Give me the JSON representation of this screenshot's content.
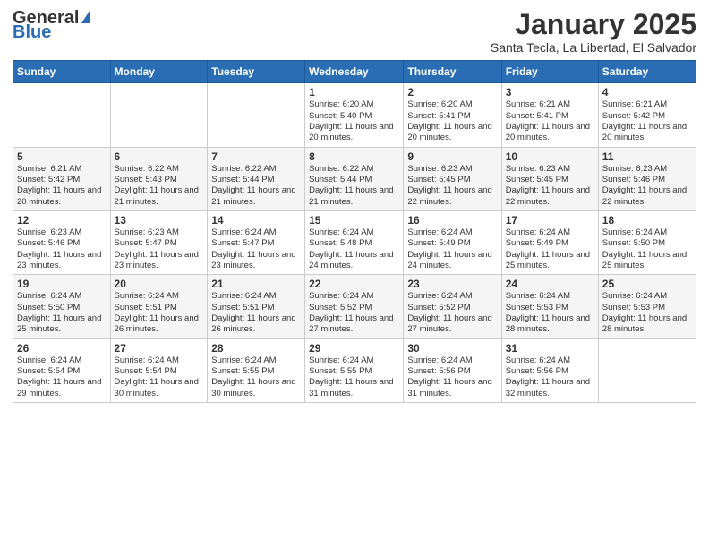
{
  "logo": {
    "general": "General",
    "blue": "Blue"
  },
  "title": "January 2025",
  "subtitle": "Santa Tecla, La Libertad, El Salvador",
  "days_header": [
    "Sunday",
    "Monday",
    "Tuesday",
    "Wednesday",
    "Thursday",
    "Friday",
    "Saturday"
  ],
  "weeks": [
    [
      {
        "day": "",
        "info": ""
      },
      {
        "day": "",
        "info": ""
      },
      {
        "day": "",
        "info": ""
      },
      {
        "day": "1",
        "info": "Sunrise: 6:20 AM\nSunset: 5:40 PM\nDaylight: 11 hours and 20 minutes."
      },
      {
        "day": "2",
        "info": "Sunrise: 6:20 AM\nSunset: 5:41 PM\nDaylight: 11 hours and 20 minutes."
      },
      {
        "day": "3",
        "info": "Sunrise: 6:21 AM\nSunset: 5:41 PM\nDaylight: 11 hours and 20 minutes."
      },
      {
        "day": "4",
        "info": "Sunrise: 6:21 AM\nSunset: 5:42 PM\nDaylight: 11 hours and 20 minutes."
      }
    ],
    [
      {
        "day": "5",
        "info": "Sunrise: 6:21 AM\nSunset: 5:42 PM\nDaylight: 11 hours and 20 minutes."
      },
      {
        "day": "6",
        "info": "Sunrise: 6:22 AM\nSunset: 5:43 PM\nDaylight: 11 hours and 21 minutes."
      },
      {
        "day": "7",
        "info": "Sunrise: 6:22 AM\nSunset: 5:44 PM\nDaylight: 11 hours and 21 minutes."
      },
      {
        "day": "8",
        "info": "Sunrise: 6:22 AM\nSunset: 5:44 PM\nDaylight: 11 hours and 21 minutes."
      },
      {
        "day": "9",
        "info": "Sunrise: 6:23 AM\nSunset: 5:45 PM\nDaylight: 11 hours and 22 minutes."
      },
      {
        "day": "10",
        "info": "Sunrise: 6:23 AM\nSunset: 5:45 PM\nDaylight: 11 hours and 22 minutes."
      },
      {
        "day": "11",
        "info": "Sunrise: 6:23 AM\nSunset: 5:46 PM\nDaylight: 11 hours and 22 minutes."
      }
    ],
    [
      {
        "day": "12",
        "info": "Sunrise: 6:23 AM\nSunset: 5:46 PM\nDaylight: 11 hours and 23 minutes."
      },
      {
        "day": "13",
        "info": "Sunrise: 6:23 AM\nSunset: 5:47 PM\nDaylight: 11 hours and 23 minutes."
      },
      {
        "day": "14",
        "info": "Sunrise: 6:24 AM\nSunset: 5:47 PM\nDaylight: 11 hours and 23 minutes."
      },
      {
        "day": "15",
        "info": "Sunrise: 6:24 AM\nSunset: 5:48 PM\nDaylight: 11 hours and 24 minutes."
      },
      {
        "day": "16",
        "info": "Sunrise: 6:24 AM\nSunset: 5:49 PM\nDaylight: 11 hours and 24 minutes."
      },
      {
        "day": "17",
        "info": "Sunrise: 6:24 AM\nSunset: 5:49 PM\nDaylight: 11 hours and 25 minutes."
      },
      {
        "day": "18",
        "info": "Sunrise: 6:24 AM\nSunset: 5:50 PM\nDaylight: 11 hours and 25 minutes."
      }
    ],
    [
      {
        "day": "19",
        "info": "Sunrise: 6:24 AM\nSunset: 5:50 PM\nDaylight: 11 hours and 25 minutes."
      },
      {
        "day": "20",
        "info": "Sunrise: 6:24 AM\nSunset: 5:51 PM\nDaylight: 11 hours and 26 minutes."
      },
      {
        "day": "21",
        "info": "Sunrise: 6:24 AM\nSunset: 5:51 PM\nDaylight: 11 hours and 26 minutes."
      },
      {
        "day": "22",
        "info": "Sunrise: 6:24 AM\nSunset: 5:52 PM\nDaylight: 11 hours and 27 minutes."
      },
      {
        "day": "23",
        "info": "Sunrise: 6:24 AM\nSunset: 5:52 PM\nDaylight: 11 hours and 27 minutes."
      },
      {
        "day": "24",
        "info": "Sunrise: 6:24 AM\nSunset: 5:53 PM\nDaylight: 11 hours and 28 minutes."
      },
      {
        "day": "25",
        "info": "Sunrise: 6:24 AM\nSunset: 5:53 PM\nDaylight: 11 hours and 28 minutes."
      }
    ],
    [
      {
        "day": "26",
        "info": "Sunrise: 6:24 AM\nSunset: 5:54 PM\nDaylight: 11 hours and 29 minutes."
      },
      {
        "day": "27",
        "info": "Sunrise: 6:24 AM\nSunset: 5:54 PM\nDaylight: 11 hours and 30 minutes."
      },
      {
        "day": "28",
        "info": "Sunrise: 6:24 AM\nSunset: 5:55 PM\nDaylight: 11 hours and 30 minutes."
      },
      {
        "day": "29",
        "info": "Sunrise: 6:24 AM\nSunset: 5:55 PM\nDaylight: 11 hours and 31 minutes."
      },
      {
        "day": "30",
        "info": "Sunrise: 6:24 AM\nSunset: 5:56 PM\nDaylight: 11 hours and 31 minutes."
      },
      {
        "day": "31",
        "info": "Sunrise: 6:24 AM\nSunset: 5:56 PM\nDaylight: 11 hours and 32 minutes."
      },
      {
        "day": "",
        "info": ""
      }
    ]
  ]
}
